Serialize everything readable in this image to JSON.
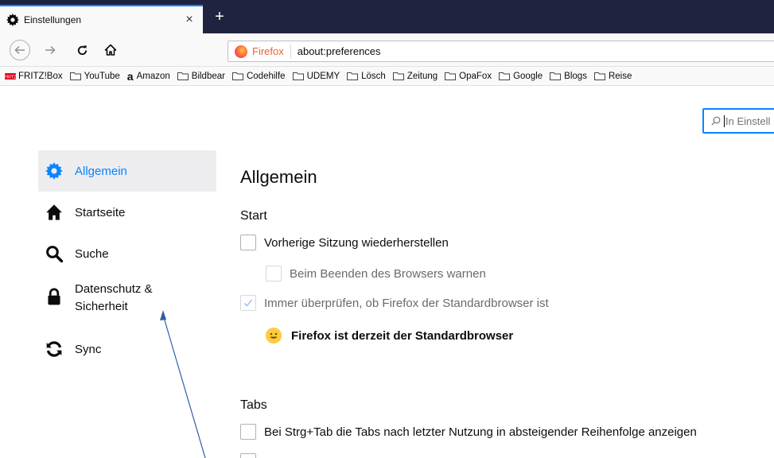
{
  "tab": {
    "title": "Einstellungen",
    "close": "×",
    "new_tab": "+"
  },
  "urlbar": {
    "identity": "Firefox",
    "url": "about:preferences"
  },
  "bookmarks": [
    {
      "label": "FRITZ!Box",
      "icon": "fritz-icon"
    },
    {
      "label": "YouTube",
      "icon": "folder-icon"
    },
    {
      "label": "Amazon",
      "icon": "amazon-icon"
    },
    {
      "label": "Bildbear",
      "icon": "folder-icon"
    },
    {
      "label": "Codehilfe",
      "icon": "folder-icon"
    },
    {
      "label": "UDEMY",
      "icon": "folder-icon"
    },
    {
      "label": "Lösch",
      "icon": "folder-icon"
    },
    {
      "label": "Zeitung",
      "icon": "folder-icon"
    },
    {
      "label": "OpaFox",
      "icon": "folder-icon"
    },
    {
      "label": "Google",
      "icon": "folder-icon"
    },
    {
      "label": "Blogs",
      "icon": "folder-icon"
    },
    {
      "label": "Reise",
      "icon": "folder-icon"
    }
  ],
  "search": {
    "placeholder": "In Einstell"
  },
  "sidebar": {
    "items": [
      {
        "label": "Allgemein",
        "icon": "gear-icon",
        "active": true
      },
      {
        "label": "Startseite",
        "icon": "home-icon"
      },
      {
        "label": "Suche",
        "icon": "search-icon"
      },
      {
        "label": "Datenschutz &",
        "label2": "Sicherheit",
        "icon": "lock-icon"
      },
      {
        "label": "Sync",
        "icon": "sync-icon"
      }
    ]
  },
  "main": {
    "title": "Allgemein",
    "start_heading": "Start",
    "restore_session": "Vorherige Sitzung wiederherstellen",
    "warn_on_quit": "Beim Beenden des Browsers warnen",
    "check_default": "Immer überprüfen, ob Firefox der Standardbrowser ist",
    "is_default": "Firefox ist derzeit der Standardbrowser",
    "tabs_heading": "Tabs",
    "ctrl_tab": "Bei Strg+Tab die Tabs nach letzter Nutzung in absteigender Reihenfolge anzeigen"
  },
  "colors": {
    "accent": "#0a84ff",
    "tabbar": "#202340",
    "active_bg": "#ededf0"
  }
}
